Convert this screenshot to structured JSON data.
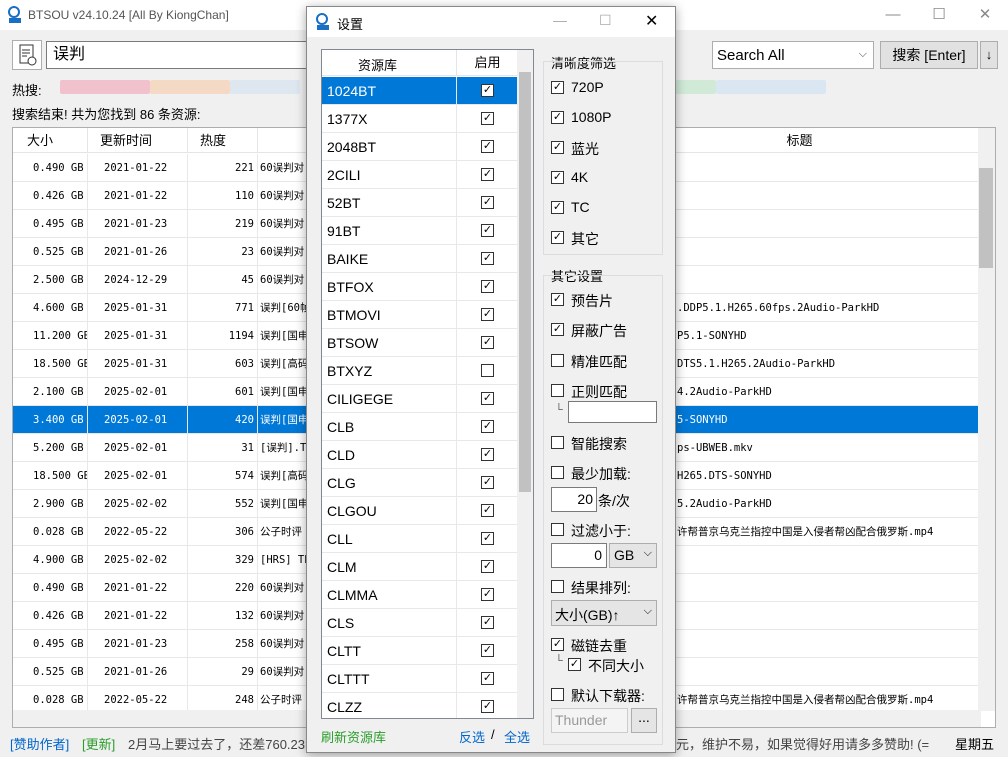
{
  "app": {
    "title": "BTSOU v24.10.24 [All By KiongChan]"
  },
  "search": {
    "keyword": "误判",
    "engine": "Search All",
    "button": "搜索 [Enter]",
    "dl": "↓"
  },
  "hot_label": "热搜:",
  "status_text": "搜索结束! 共为您找到 86 条资源:",
  "table": {
    "headers": {
      "size": "大小",
      "time": "更新时间",
      "heat": "热度",
      "title": "标题"
    },
    "rows": [
      {
        "size": "0.490 GB",
        "time": "2021-01-22",
        "heat": "221",
        "t1": "60误判对",
        "t2": ""
      },
      {
        "size": "0.426 GB",
        "time": "2021-01-22",
        "heat": "110",
        "t1": "60误判对",
        "t2": ""
      },
      {
        "size": "0.495 GB",
        "time": "2021-01-23",
        "heat": "219",
        "t1": "60误判对",
        "t2": ""
      },
      {
        "size": "0.525 GB",
        "time": "2021-01-26",
        "heat": "23",
        "t1": "60误判对",
        "t2": ""
      },
      {
        "size": "2.500 GB",
        "time": "2024-12-29",
        "heat": "45",
        "t1": "60误判对",
        "t2": ""
      },
      {
        "size": "4.600 GB",
        "time": "2025-01-31",
        "heat": "771",
        "t1": "误判[60帧",
        "t2": ".DDP5.1.H265.60fps.2Audio-ParkHD"
      },
      {
        "size": "11.200 GB",
        "time": "2025-01-31",
        "heat": "1194",
        "t1": "误判[国申",
        "t2": "P5.1-SONYHD"
      },
      {
        "size": "18.500 GB",
        "time": "2025-01-31",
        "heat": "603",
        "t1": "误判[高码",
        "t2": "DTS5.1.H265.2Audio-ParkHD"
      },
      {
        "size": "2.100 GB",
        "time": "2025-02-01",
        "heat": "601",
        "t1": "误判[国申",
        "t2": "4.2Audio-ParkHD"
      },
      {
        "size": "3.400 GB",
        "time": "2025-02-01",
        "heat": "420",
        "t1": "误判[国申",
        "t2": "5-SONYHD",
        "sel": true
      },
      {
        "size": "5.200 GB",
        "time": "2025-02-01",
        "heat": "31",
        "t1": "[误判].T",
        "t2": "ps-UBWEB.mkv"
      },
      {
        "size": "18.500 GB",
        "time": "2025-02-01",
        "heat": "574",
        "t1": "误判[高码",
        "t2": "H265.DTS-SONYHD"
      },
      {
        "size": "2.900 GB",
        "time": "2025-02-02",
        "heat": "552",
        "t1": "误判[国申",
        "t2": "5.2Audio-ParkHD"
      },
      {
        "size": "0.028 GB",
        "time": "2022-05-22",
        "heat": "306",
        "t1": "公子时评",
        "t2": "许帮普京乌克兰指控中国是入侵者帮凶配合俄罗斯.mp4"
      },
      {
        "size": "4.900 GB",
        "time": "2025-02-02",
        "heat": "329",
        "t1": "[HRS] Th",
        "t2": ""
      },
      {
        "size": "0.490 GB",
        "time": "2021-01-22",
        "heat": "220",
        "t1": "60误判对",
        "t2": ""
      },
      {
        "size": "0.426 GB",
        "time": "2021-01-22",
        "heat": "132",
        "t1": "60误判对",
        "t2": ""
      },
      {
        "size": "0.495 GB",
        "time": "2021-01-23",
        "heat": "258",
        "t1": "60误判对",
        "t2": ""
      },
      {
        "size": "0.525 GB",
        "time": "2021-01-26",
        "heat": "29",
        "t1": "60误判对",
        "t2": ""
      },
      {
        "size": "0.028 GB",
        "time": "2022-05-22",
        "heat": "248",
        "t1": "公子时评",
        "t2": "许帮普京乌克兰指控中国是入侵者帮凶配合俄罗斯.mp4"
      }
    ]
  },
  "bottom": {
    "sponsor": "[赞助作者]",
    "update": "[更新]",
    "msg": "2月马上要过去了，还差760.23",
    "msg2": "元，维护不易，如果觉得好用请多多赞助! (=",
    "day": "星期五"
  },
  "dialog": {
    "title": "设置",
    "list_headers": {
      "name": "资源库",
      "enabled": "启用"
    },
    "sources": [
      {
        "name": "1024BT",
        "on": true,
        "sel": true
      },
      {
        "name": "1377X",
        "on": true
      },
      {
        "name": "2048BT",
        "on": true
      },
      {
        "name": "2CILI",
        "on": true
      },
      {
        "name": "52BT",
        "on": true
      },
      {
        "name": "91BT",
        "on": true
      },
      {
        "name": "BAIKE",
        "on": true
      },
      {
        "name": "BTFOX",
        "on": true
      },
      {
        "name": "BTMOVI",
        "on": true
      },
      {
        "name": "BTSOW",
        "on": true
      },
      {
        "name": "BTXYZ",
        "on": false
      },
      {
        "name": "CILIGEGE",
        "on": true
      },
      {
        "name": "CLB",
        "on": true
      },
      {
        "name": "CLD",
        "on": true
      },
      {
        "name": "CLG",
        "on": true
      },
      {
        "name": "CLGOU",
        "on": true
      },
      {
        "name": "CLL",
        "on": true
      },
      {
        "name": "CLM",
        "on": true
      },
      {
        "name": "CLMMA",
        "on": true
      },
      {
        "name": "CLS",
        "on": true
      },
      {
        "name": "CLTT",
        "on": true
      },
      {
        "name": "CLTTT",
        "on": true
      },
      {
        "name": "CLZZ",
        "on": true
      }
    ],
    "refresh": "刷新资源库",
    "invert": "反选",
    "sep": "/",
    "select_all": "全选",
    "res_title": "清晰度筛选",
    "res": [
      {
        "label": "720P",
        "on": true
      },
      {
        "label": "1080P",
        "on": true
      },
      {
        "label": "蓝光",
        "on": true
      },
      {
        "label": "4K",
        "on": true
      },
      {
        "label": "TC",
        "on": true
      },
      {
        "label": "其它",
        "on": true
      }
    ],
    "other_title": "其它设置",
    "trailer": "预告片",
    "block_ads": "屏蔽广告",
    "exact": "精准匹配",
    "regex": "正则匹配",
    "smart": "智能搜索",
    "min_load": "最少加载:",
    "min_load_val": "20",
    "min_load_unit": "条/次",
    "filter": "过滤小于:",
    "filter_val": "0",
    "filter_unit": "GB",
    "sort": "结果排列:",
    "sort_val": "大小(GB)↑",
    "dedupe": "磁链去重",
    "case": "不同大小",
    "downloader": "默认下载器:",
    "downloader_val": "Thunder",
    "browse": "..."
  }
}
